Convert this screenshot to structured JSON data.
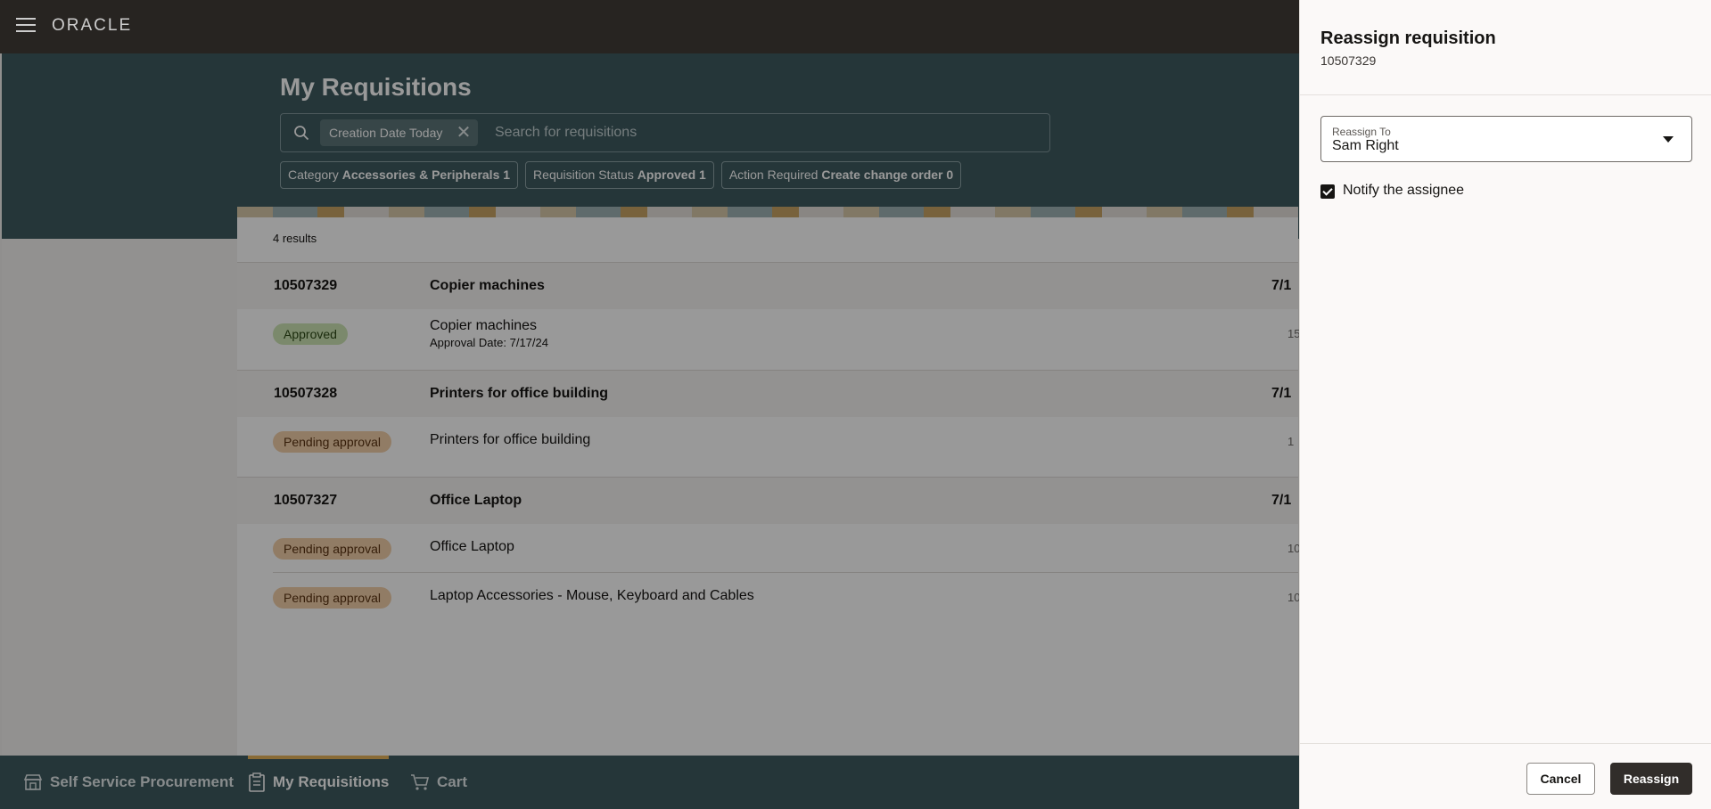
{
  "app": {
    "logo": "ORACLE"
  },
  "header": {
    "title": "My Requisitions",
    "search": {
      "chip": "Creation Date Today",
      "placeholder": "Search for requisitions"
    },
    "filters": [
      {
        "label": "Category",
        "value": "Accessories & Peripherals",
        "count": "1"
      },
      {
        "label": "Requisition Status",
        "value": "Approved",
        "count": "1"
      },
      {
        "label": "Action Required",
        "value": "Create change order",
        "count": "0"
      }
    ]
  },
  "results": {
    "count": "4 results",
    "groups": [
      {
        "number": "10507329",
        "title": "Copier machines",
        "date": "7/1",
        "lines": [
          {
            "status": "Approved",
            "status_type": "approved",
            "description": "Copier machines",
            "sub": "Approval Date: 7/17/24",
            "amount": "15"
          }
        ]
      },
      {
        "number": "10507328",
        "title": "Printers for office building",
        "date": "7/1",
        "lines": [
          {
            "status": "Pending approval",
            "status_type": "pending",
            "description": "Printers for office building",
            "amount": "1"
          }
        ]
      },
      {
        "number": "10507327",
        "title": "Office Laptop",
        "date": "7/1",
        "lines": [
          {
            "status": "Pending approval",
            "status_type": "pending",
            "description": "Office Laptop",
            "amount": "10"
          },
          {
            "status": "Pending approval",
            "status_type": "pending",
            "description": "Laptop Accessories - Mouse, Keyboard and Cables",
            "amount": "10"
          }
        ]
      }
    ]
  },
  "bottom_nav": {
    "items": [
      {
        "label": "Self Service Procurement",
        "icon": "store-icon"
      },
      {
        "label": "My Requisitions",
        "icon": "clipboard-icon"
      },
      {
        "label": "Cart",
        "icon": "cart-icon"
      }
    ]
  },
  "drawer": {
    "title": "Reassign requisition",
    "subtitle": "10507329",
    "reassign_to": {
      "label": "Reassign To",
      "value": "Sam Right"
    },
    "notify": {
      "label": "Notify the assignee",
      "checked": true
    },
    "cancel_label": "Cancel",
    "reassign_label": "Reassign"
  }
}
